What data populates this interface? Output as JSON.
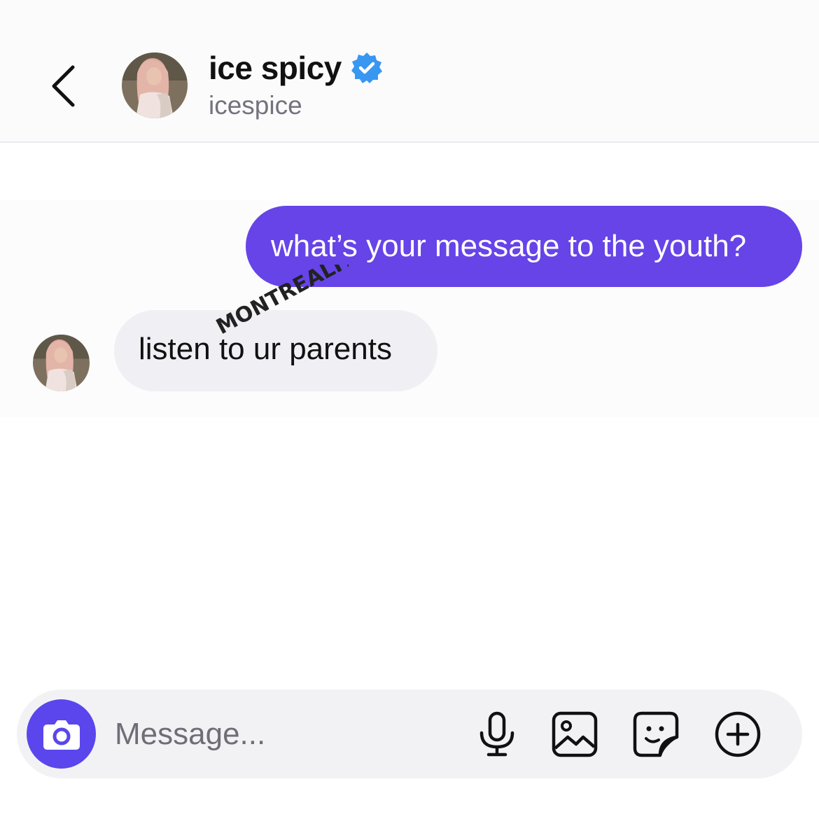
{
  "header": {
    "display_name": "ice spicy",
    "username": "icespice",
    "verified": true
  },
  "messages": [
    {
      "direction": "sent",
      "text": "what’s your message to the youth?"
    },
    {
      "direction": "received",
      "text": "listen to ur parents"
    }
  ],
  "watermark": "MONTREALITY",
  "composer": {
    "placeholder": "Message..."
  },
  "icons": [
    "back-chevron-icon",
    "verified-badge-icon",
    "camera-icon",
    "microphone-icon",
    "image-icon",
    "sticker-icon",
    "plus-circle-icon"
  ],
  "colors": {
    "sent_bubble": "#6644e8",
    "received_bubble": "#efeff4",
    "camera_button": "#5a46ec",
    "verified_badge": "#3897f0",
    "username_text": "#73737d"
  }
}
